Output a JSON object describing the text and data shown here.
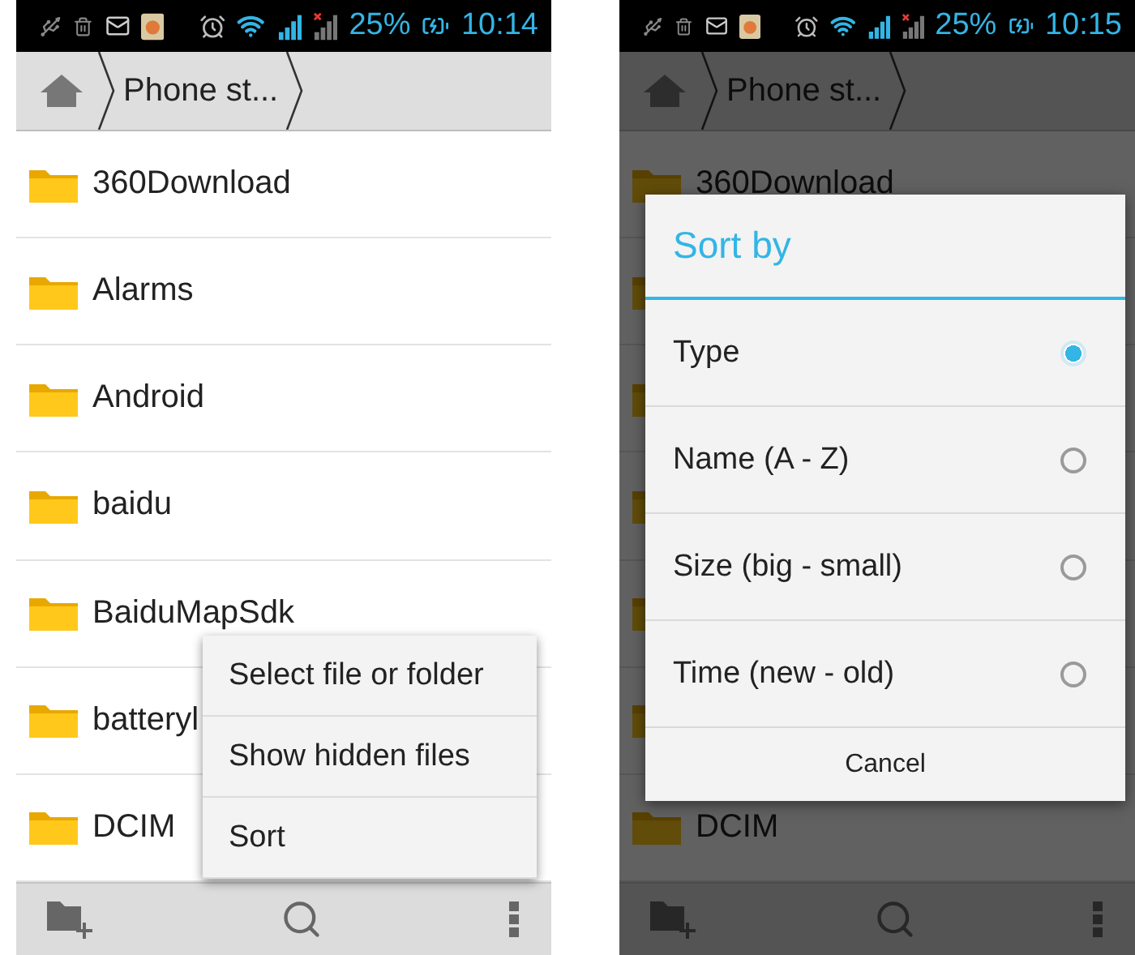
{
  "phones": [
    {
      "status_bar": {
        "battery": "25%",
        "time": "10:14"
      },
      "breadcrumb": "Phone st...",
      "folders": [
        {
          "name": "360Download"
        },
        {
          "name": "Alarms"
        },
        {
          "name": "Android"
        },
        {
          "name": "baidu"
        },
        {
          "name": "BaiduMapSdk"
        },
        {
          "name": "batteryl"
        },
        {
          "name": "DCIM"
        }
      ],
      "menu": {
        "items": [
          "Select file or folder",
          "Show hidden files",
          "Sort"
        ]
      }
    },
    {
      "status_bar": {
        "battery": "25%",
        "time": "10:15"
      },
      "breadcrumb": "Phone st...",
      "folders": [
        {
          "name": "360Download"
        },
        {
          "name": "DCIM"
        }
      ],
      "dialog": {
        "title": "Sort by",
        "options": [
          {
            "label": "Type",
            "selected": true
          },
          {
            "label": "Name (A - Z)",
            "selected": false
          },
          {
            "label": "Size (big - small)",
            "selected": false
          },
          {
            "label": "Time (new - old)",
            "selected": false
          }
        ],
        "cancel": "Cancel"
      }
    }
  ]
}
